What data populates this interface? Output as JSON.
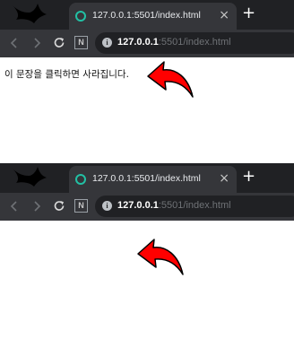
{
  "screens": [
    {
      "tab": {
        "title": "127.0.0.1:5501/index.html",
        "close": "×"
      },
      "new_tab": "+",
      "toolbar": {
        "ext_label": "N",
        "url_host": "127.0.0.1",
        "url_path": ":5501/index.html"
      },
      "content": {
        "message": "이 문장을 클릭하면 사라집니다.",
        "arrow": "red-curved-arrow"
      }
    },
    {
      "tab": {
        "title": "127.0.0.1:5501/index.html",
        "close": "×"
      },
      "new_tab": "+",
      "toolbar": {
        "ext_label": "N",
        "url_host": "127.0.0.1",
        "url_path": ":5501/index.html"
      },
      "content": {
        "message": "",
        "arrow": "red-curved-arrow"
      }
    }
  ],
  "colors": {
    "accent": "#ff0000",
    "tabstrip": "#202124",
    "toolbar": "#35363a",
    "favicon": "#22c0a4"
  }
}
